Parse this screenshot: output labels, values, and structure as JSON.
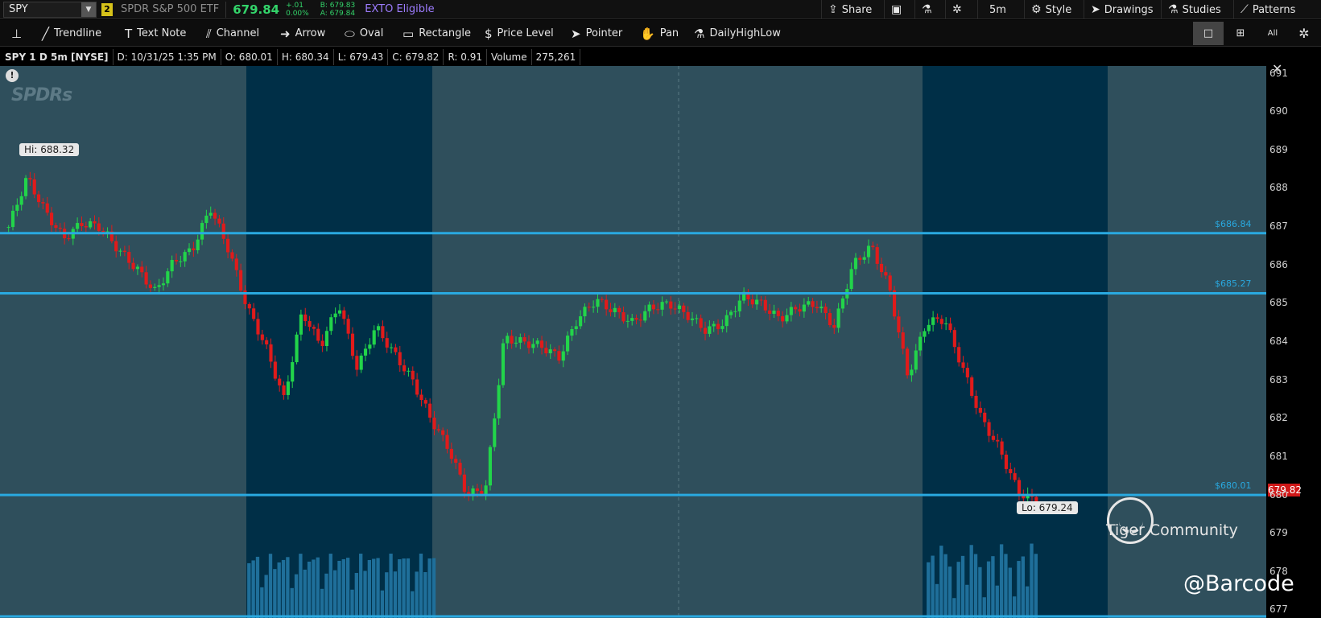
{
  "topbar": {
    "symbol": "SPY",
    "link_badge": "2",
    "description": "SPDR S&P 500 ETF",
    "last": "679.84",
    "change_abs": "+.01",
    "change_pct": "0.00%",
    "bid": "B: 679.83",
    "ask": "A: 679.84",
    "exto": "EXTO Eligible",
    "share_label": "Share",
    "timeframe_label": "5m",
    "style_label": "Style",
    "drawings_label": "Drawings",
    "studies_label": "Studies",
    "patterns_label": "Patterns"
  },
  "drawbar": {
    "tools": [
      {
        "label": "Trendline"
      },
      {
        "label": "Text Note"
      },
      {
        "label": "Channel"
      },
      {
        "label": "Arrow"
      },
      {
        "label": "Oval"
      },
      {
        "label": "Rectangle"
      },
      {
        "label": "Price Level"
      },
      {
        "label": "Pointer"
      },
      {
        "label": "Pan"
      },
      {
        "label": "DailyHighLow"
      }
    ],
    "all_label": "All"
  },
  "info": {
    "title": "SPY 1 D 5m [NYSE]",
    "date": "D: 10/31/25 1:35 PM",
    "open": "O: 680.01",
    "high": "H: 680.34",
    "low": "L: 679.43",
    "close": "C: 679.82",
    "range": "R: 0.91",
    "volume_label": "Volume",
    "volume": "275,261"
  },
  "chart": {
    "logo_text": "SPDRs",
    "hi_callout": "Hi: 688.32",
    "lo_callout": "Lo: 679.24",
    "price_tag": "679.82",
    "watermark_community": "Tiger Community",
    "watermark_handle": "@Barcode",
    "y_ticks": [
      "691",
      "690",
      "689",
      "688",
      "687",
      "686",
      "685",
      "684",
      "683",
      "682",
      "681",
      "680",
      "679",
      "678",
      "677"
    ],
    "levels": [
      "$686.84",
      "$685.27",
      "$680.01"
    ],
    "colors": {
      "up": "#22d44a",
      "down": "#e01b1b",
      "level": "#29a9e0",
      "session": "#002f47",
      "ext": "#2f4f5c",
      "volume": "#1f6f9a"
    }
  },
  "chart_data": {
    "type": "candlestick",
    "title": "SPY 1 D 5m [NYSE]",
    "ylim": [
      676.8,
      691.2
    ],
    "high": 688.32,
    "low": 679.24,
    "last": 679.82,
    "price_levels": [
      686.84,
      685.27,
      680.01
    ],
    "y_ticks": [
      677,
      678,
      679,
      680,
      681,
      682,
      683,
      684,
      685,
      686,
      687,
      688,
      689,
      690,
      691
    ],
    "close_path": [
      687.0,
      688.3,
      687.4,
      686.7,
      687.1,
      687.0,
      686.4,
      685.9,
      685.3,
      686.1,
      686.4,
      687.5,
      686.4,
      684.9,
      683.9,
      682.5,
      684.8,
      683.9,
      685.0,
      683.3,
      684.4,
      683.7,
      683.0,
      682.0,
      681.2,
      680.0,
      680.2,
      684.1,
      684.0,
      683.9,
      683.6,
      684.6,
      685.1,
      684.8,
      684.5,
      684.9,
      685.0,
      684.7,
      684.3,
      684.5,
      685.2,
      685.0,
      684.6,
      684.9,
      685.0,
      684.4,
      686.0,
      686.5,
      685.4,
      683.1,
      684.5,
      684.6,
      683.3,
      682.0,
      681.2,
      680.1,
      679.82
    ]
  }
}
